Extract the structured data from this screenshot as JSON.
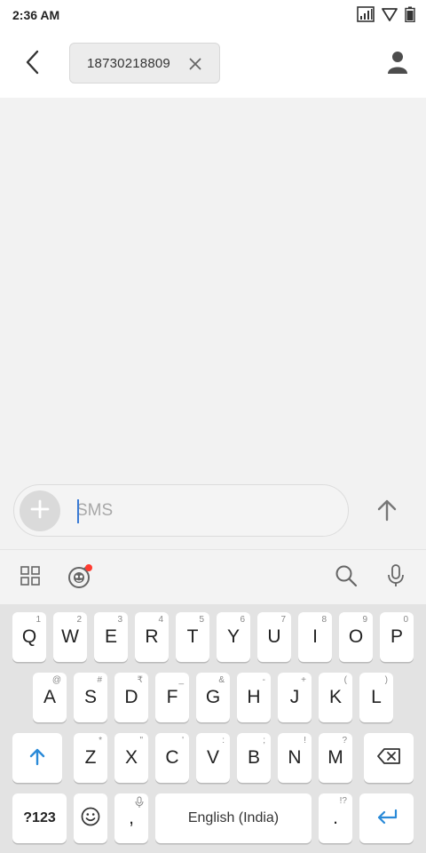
{
  "status_bar": {
    "time": "2:36 AM",
    "icons": [
      "signal-icon",
      "wifi-icon",
      "battery-icon"
    ]
  },
  "header": {
    "back_icon": "back-arrow-icon",
    "recipient": "18730218809",
    "remove_icon": "close-icon",
    "contact_icon": "person-icon"
  },
  "compose": {
    "add_icon": "plus-icon",
    "placeholder": "SMS",
    "value": "",
    "send_icon": "arrow-up-icon"
  },
  "keyboard_toolbar": {
    "icons": [
      "apps-grid-icon",
      "sticker-icon",
      "search-icon",
      "microphone-icon"
    ]
  },
  "keyboard": {
    "row1": [
      {
        "key": "Q",
        "hint": "1"
      },
      {
        "key": "W",
        "hint": "2"
      },
      {
        "key": "E",
        "hint": "3"
      },
      {
        "key": "R",
        "hint": "4"
      },
      {
        "key": "T",
        "hint": "5"
      },
      {
        "key": "Y",
        "hint": "6"
      },
      {
        "key": "U",
        "hint": "7"
      },
      {
        "key": "I",
        "hint": "8"
      },
      {
        "key": "O",
        "hint": "9"
      },
      {
        "key": "P",
        "hint": "0"
      }
    ],
    "row2": [
      {
        "key": "A",
        "hint": "@"
      },
      {
        "key": "S",
        "hint": "#"
      },
      {
        "key": "D",
        "hint": "₹"
      },
      {
        "key": "F",
        "hint": "_"
      },
      {
        "key": "G",
        "hint": "&"
      },
      {
        "key": "H",
        "hint": "-"
      },
      {
        "key": "J",
        "hint": "+"
      },
      {
        "key": "K",
        "hint": "("
      },
      {
        "key": "L",
        "hint": ")"
      }
    ],
    "row3": [
      {
        "key": "Z",
        "hint": "*"
      },
      {
        "key": "X",
        "hint": "\""
      },
      {
        "key": "C",
        "hint": "'"
      },
      {
        "key": "V",
        "hint": ":"
      },
      {
        "key": "B",
        "hint": ";"
      },
      {
        "key": "N",
        "hint": "!"
      },
      {
        "key": "M",
        "hint": "?"
      }
    ],
    "shift_icon": "shift-arrow-icon",
    "backspace_icon": "backspace-icon",
    "symbols_label": "?123",
    "emoji_icon": "emoji-icon",
    "comma_label": ",",
    "space_label": "English (India)",
    "period_label": ".",
    "period_hint": "!?",
    "enter_icon": "enter-icon",
    "accent_color": "#2a8ad8"
  }
}
